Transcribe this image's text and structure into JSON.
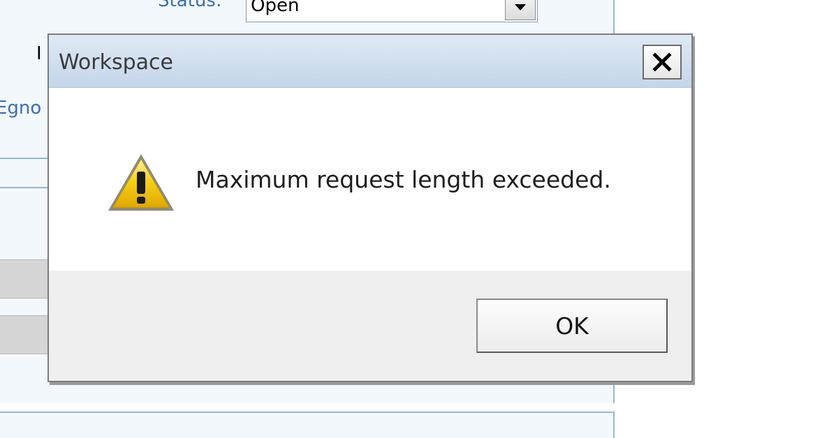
{
  "background_form": {
    "status_label": "Status:",
    "status_value": "Open",
    "edge_text_1": "I",
    "edge_text_2": "Egno"
  },
  "dialog": {
    "title": "Workspace",
    "message": "Maximum request length exceeded.",
    "ok_label": "OK",
    "icons": {
      "close": "close-icon",
      "warning": "warning-icon",
      "dropdown": "chevron-down-icon"
    }
  },
  "colors": {
    "titlebar": "#c4d6ea",
    "link_blue": "#3b6fb3",
    "warning_yellow": "#f2c200",
    "footer_gray": "#efefef"
  }
}
